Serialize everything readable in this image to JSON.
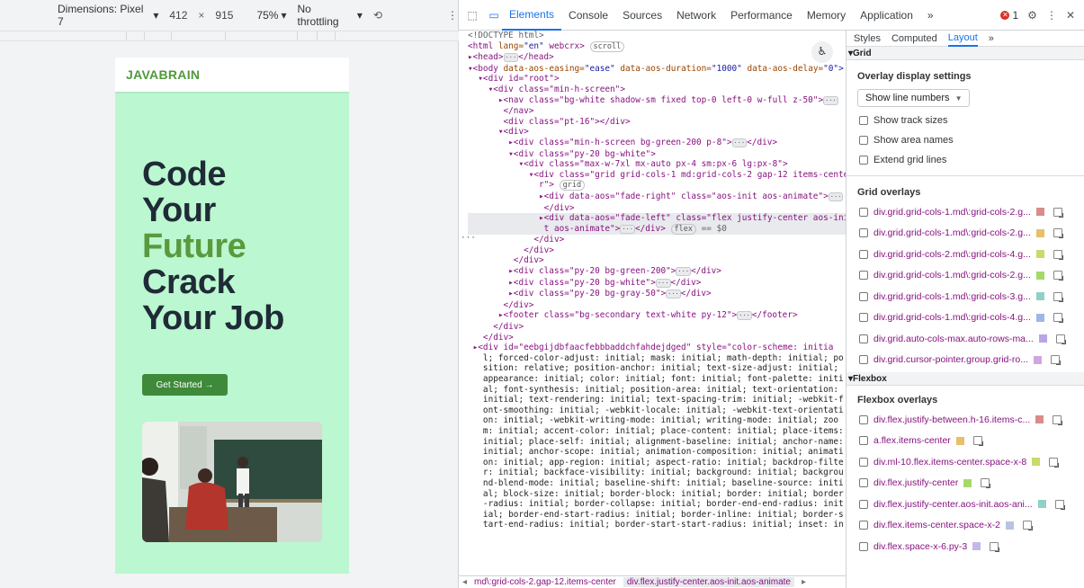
{
  "device_toolbar": {
    "dimensions_label": "Dimensions: Pixel 7",
    "width": "412",
    "height": "915",
    "zoom": "75%",
    "throttling": "No throttling"
  },
  "preview": {
    "brand": "JAVABRAIN",
    "hero_line1": "Code",
    "hero_line2": "Your",
    "hero_line3": "Future",
    "hero_line4": "Crack",
    "hero_line5": "Your Job",
    "cta": "Get Started →"
  },
  "devtools": {
    "tabs": [
      "Elements",
      "Console",
      "Sources",
      "Network",
      "Performance",
      "Memory",
      "Application"
    ],
    "more": "»",
    "error_count": "1",
    "subtabs": [
      "Styles",
      "Computed",
      "Layout"
    ]
  },
  "code": {
    "l0": "<!DOCTYPE html>",
    "l1_tag": "<html ",
    "l1_attr": "lang=",
    "l1_val": "\"en\"",
    "l1_rest": " webcrx>",
    "l1_pill": "scroll",
    "l2": "▸<head>",
    "l2b": "</head>",
    "l3a": "▾<body ",
    "l3b": "data-aos-easing=",
    "l3c": "\"ease\"",
    "l3d": " data-aos-duration=",
    "l3e": "\"1000\"",
    "l3f": " data-aos-delay=",
    "l3g": "\"0\">",
    "l4": "  ▾<div id=\"root\">",
    "l5": "    ▾<div class=\"min-h-screen\">",
    "l6": "      ▸<nav class=\"bg-white shadow-sm fixed top-0 left-0 w-full z-50\">",
    "l7": "       </nav>",
    "l8": "       <div class=\"pt-16\"></div>",
    "l9": "      ▾<div>",
    "l10": "        ▸<div class=\"min-h-screen bg-green-200 p-8\">",
    "l10b": "</div>",
    "l11": "        ▾<div class=\"py-20 bg-white\">",
    "l12": "          ▾<div class=\"max-w-7xl mx-auto px-4 sm:px-6 lg:px-8\">",
    "l13": "            ▾<div class=\"grid grid-cols-1 md:grid-cols-2 gap-12 items-cente",
    "l13b": "              r\">",
    "l13_pill": "grid",
    "l14": "              ▸<div data-aos=\"fade-right\" class=\"aos-init aos-animate\">",
    "l15": "               </div>",
    "l16": "              ▸<div data-aos=\"fade-left\" class=\"flex justify-center aos-ini",
    "l17": "               t aos-animate\">",
    "l17b": "</div>",
    "l17_pill": "flex",
    "l17_eq": " == $0",
    "l18": "             </div>",
    "l19": "           </div>",
    "l20": "         </div>",
    "l21": "        ▸<div class=\"py-20 bg-green-200\">",
    "l22": "        ▸<div class=\"py-20 bg-white\">",
    "l23": "        ▸<div class=\"py-20 bg-gray-50\">",
    "l24": "       </div>",
    "l25": "      ▸<footer class=\"bg-secondary text-white py-12\">",
    "l25b": "</footer>",
    "l26": "     </div>",
    "l27": "   </div>",
    "l28": " ▸<div id=\"eebgijdbfaacfebbbaddchfahdejdged\" style=\"color-scheme: initia",
    "style_lines": [
      "   l; forced-color-adjust: initial; mask: initial; math-depth: initial; po",
      "   sition: relative; position-anchor: initial; text-size-adjust: initial;",
      "   appearance: initial; color: initial; font: initial; font-palette: initi",
      "   al; font-synthesis: initial; position-area: initial; text-orientation:",
      "   initial; text-rendering: initial; text-spacing-trim: initial; -webkit-f",
      "   ont-smoothing: initial; -webkit-locale: initial; -webkit-text-orientati",
      "   on: initial; -webkit-writing-mode: initial; writing-mode: initial; zoo",
      "   m: initial; accent-color: initial; place-content: initial; place-items:",
      "   initial; place-self: initial; alignment-baseline: initial; anchor-name:",
      "   initial; anchor-scope: initial; animation-composition: initial; animati",
      "   on: initial; app-region: initial; aspect-ratio: initial; backdrop-filte",
      "   r: initial; backface-visibility: initial; background: initial; backgrou",
      "   nd-blend-mode: initial; baseline-shift: initial; baseline-source: initi",
      "   al; block-size: initial; border-block: initial; border: initial; border",
      "   -radius: initial; border-collapse: initial; border-end-end-radius: init",
      "   ial; border-end-start-radius: initial; border-inline: initial; border-s",
      "   tart-end-radius: initial; border-start-start-radius: initial; inset: in"
    ]
  },
  "breadcrumbs": {
    "c1": "md\\:grid-cols-2.gap-12.items-center",
    "c2": "div.flex.justify-center.aos-init.aos-animate"
  },
  "layout_pane": {
    "grid_header": "Grid",
    "overlay_settings_title": "Overlay display settings",
    "line_numbers": "Show line numbers",
    "options": [
      "Show track sizes",
      "Show area names",
      "Extend grid lines"
    ],
    "grid_overlays_title": "Grid overlays",
    "grid_overlays": [
      {
        "name": "div.grid.grid-cols-1.md\\:grid-cols-2.g...",
        "color": "#d98c8c"
      },
      {
        "name": "div.grid.grid-cols-1.md\\:grid-cols-2.g...",
        "color": "#e6c06a"
      },
      {
        "name": "div.grid.grid-cols-2.md\\:grid-cols-4.g...",
        "color": "#c9d96b"
      },
      {
        "name": "div.grid.grid-cols-1.md\\:grid-cols-2.g...",
        "color": "#a6d96b"
      },
      {
        "name": "div.grid.grid-cols-1.md\\:grid-cols-3.g...",
        "color": "#8fd1c6"
      },
      {
        "name": "div.grid.grid-cols-1.md\\:grid-cols-4.g...",
        "color": "#9fb6e6"
      },
      {
        "name": "div.grid.auto-cols-max.auto-rows-ma...",
        "color": "#b9a5e3"
      },
      {
        "name": "div.grid.cursor-pointer.group.grid-ro...",
        "color": "#d3a5e0"
      }
    ],
    "flex_header": "Flexbox",
    "flex_overlays_title": "Flexbox overlays",
    "flex_overlays": [
      {
        "name": "div.flex.justify-between.h-16.items-c...",
        "color": "#d98c8c"
      },
      {
        "name": "a.flex.items-center",
        "color": "#e6c06a"
      },
      {
        "name": "div.ml-10.flex.items-center.space-x-8",
        "color": "#c9d96b"
      },
      {
        "name": "div.flex.justify-center",
        "color": "#a6d96b"
      },
      {
        "name": "div.flex.justify-center.aos-init.aos-ani...",
        "color": "#8fd1c6"
      },
      {
        "name": "div.flex.items-center.space-x-2",
        "color": "#b8c4e0"
      },
      {
        "name": "div.flex.space-x-6.py-3",
        "color": "#c6b8e6"
      }
    ]
  }
}
